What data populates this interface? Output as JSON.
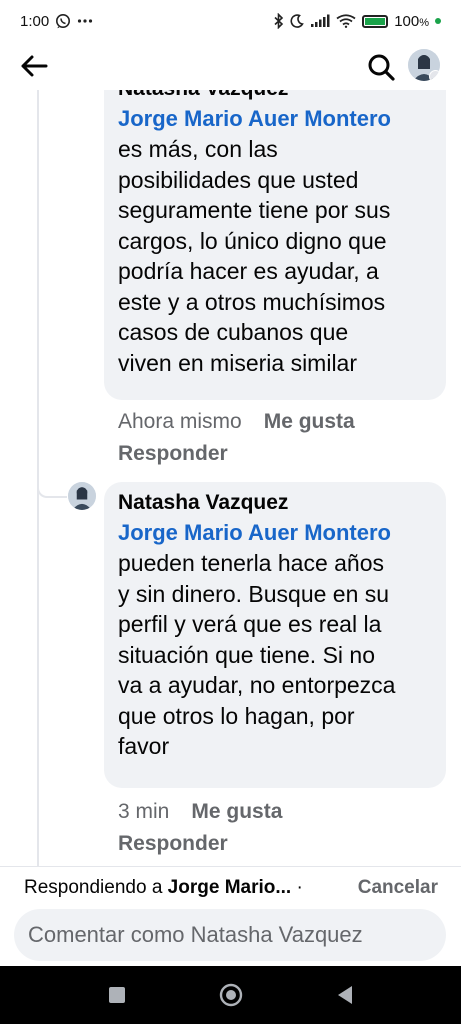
{
  "status_bar": {
    "time": "1:00",
    "battery_text": "100",
    "icons": [
      "whatsapp-icon",
      "more-dots-icon",
      "bluetooth-icon",
      "moon-icon",
      "signal-icon",
      "wifi-icon",
      "battery-icon"
    ]
  },
  "header": {
    "icons": [
      "back-arrow-icon",
      "search-icon",
      "avatar"
    ]
  },
  "comments": [
    {
      "author": "Natasha Vazquez",
      "mention": "Jorge Mario Auer Montero",
      "lines": [
        "es más, con las",
        "posibilidades que usted",
        "seguramente tiene por sus",
        "cargos, lo único digno que",
        "podría hacer es ayudar, a",
        "este y a otros muchísimos",
        "casos de cubanos que",
        "viven en miseria similar"
      ],
      "time": "Ahora mismo",
      "like_label": "Me gusta",
      "reply_label": "Responder"
    },
    {
      "author": "Natasha Vazquez",
      "mention": "Jorge Mario Auer Montero",
      "lines": [
        "pueden tenerla hace años",
        "y sin dinero. Busque en su",
        "perfil y verá que es real la",
        "situación que tiene. Si no",
        "va a ayudar, no entorpezca",
        "que otros lo hagan, por",
        "favor"
      ],
      "time": "3 min",
      "like_label": "Me gusta",
      "reply_label": "Responder"
    }
  ],
  "reply_bar": {
    "replying_prefix": "Respondiendo a",
    "replying_name": "Jorge Mario...",
    "separator": "·",
    "cancel_label": "Cancelar",
    "input_placeholder": "Comentar como Natasha Vazquez",
    "input_value": ""
  },
  "nav": {
    "icons": [
      "recents-square-icon",
      "home-circle-icon",
      "back-triangle-icon"
    ]
  },
  "colors": {
    "mention": "#1866c9",
    "bubble": "#f0f2f5",
    "meta_gray": "#65676b",
    "battery_green": "#1aa34a"
  }
}
